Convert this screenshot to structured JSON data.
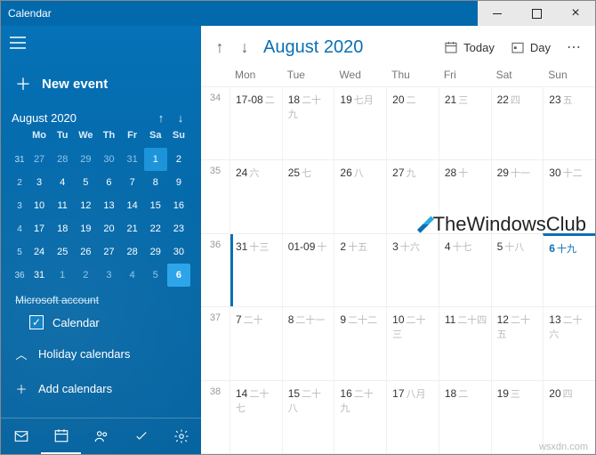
{
  "window": {
    "title": "Calendar"
  },
  "sidebar": {
    "new_event": "New event",
    "mini_month": "August 2020",
    "dows": [
      "Mo",
      "Tu",
      "We",
      "Th",
      "Fr",
      "Sa",
      "Su"
    ],
    "weeks": [
      {
        "wn": "31",
        "days": [
          {
            "n": "27",
            "cls": "prev"
          },
          {
            "n": "28",
            "cls": "prev"
          },
          {
            "n": "29",
            "cls": "prev"
          },
          {
            "n": "30",
            "cls": "prev"
          },
          {
            "n": "31",
            "cls": "prev"
          },
          {
            "n": "1",
            "cls": "hl"
          },
          {
            "n": "2",
            "cls": ""
          }
        ]
      },
      {
        "wn": "2",
        "days": [
          {
            "n": "3"
          },
          {
            "n": "4"
          },
          {
            "n": "5"
          },
          {
            "n": "6"
          },
          {
            "n": "7"
          },
          {
            "n": "8"
          },
          {
            "n": "9"
          }
        ]
      },
      {
        "wn": "3",
        "days": [
          {
            "n": "10"
          },
          {
            "n": "11"
          },
          {
            "n": "12"
          },
          {
            "n": "13"
          },
          {
            "n": "14"
          },
          {
            "n": "15"
          },
          {
            "n": "16"
          }
        ]
      },
      {
        "wn": "4",
        "days": [
          {
            "n": "17"
          },
          {
            "n": "18"
          },
          {
            "n": "19"
          },
          {
            "n": "20"
          },
          {
            "n": "21"
          },
          {
            "n": "22"
          },
          {
            "n": "23"
          }
        ]
      },
      {
        "wn": "5",
        "days": [
          {
            "n": "24"
          },
          {
            "n": "25"
          },
          {
            "n": "26"
          },
          {
            "n": "27"
          },
          {
            "n": "28"
          },
          {
            "n": "29"
          },
          {
            "n": "30"
          }
        ]
      },
      {
        "wn": "36",
        "days": [
          {
            "n": "31"
          },
          {
            "n": "1",
            "cls": "next"
          },
          {
            "n": "2",
            "cls": "next"
          },
          {
            "n": "3",
            "cls": "next"
          },
          {
            "n": "4",
            "cls": "next"
          },
          {
            "n": "5",
            "cls": "next"
          },
          {
            "n": "6",
            "cls": "sel"
          }
        ]
      }
    ],
    "account": "Microsoft account",
    "calendar_check": "Calendar",
    "holiday": "Holiday calendars",
    "add": "Add calendars"
  },
  "toolbar": {
    "title": "August 2020",
    "today": "Today",
    "day": "Day"
  },
  "main": {
    "dows": [
      "Mon",
      "Tue",
      "Wed",
      "Thu",
      "Fri",
      "Sat",
      "Sun"
    ],
    "weeks": [
      {
        "wn": "34",
        "cells": [
          {
            "d": "17-08",
            "alt": "二",
            "cls": ""
          },
          {
            "d": "18",
            "alt": "二十九"
          },
          {
            "d": "19",
            "alt": "七月"
          },
          {
            "d": "20",
            "alt": "二"
          },
          {
            "d": "21",
            "alt": "三"
          },
          {
            "d": "22",
            "alt": "四"
          },
          {
            "d": "23",
            "alt": "五"
          }
        ]
      },
      {
        "wn": "35",
        "cells": [
          {
            "d": "24",
            "alt": "六"
          },
          {
            "d": "25",
            "alt": "七"
          },
          {
            "d": "26",
            "alt": "八"
          },
          {
            "d": "27",
            "alt": "九"
          },
          {
            "d": "28",
            "alt": "十"
          },
          {
            "d": "29",
            "alt": "十一"
          },
          {
            "d": "30",
            "alt": "十二"
          }
        ]
      },
      {
        "wn": "36",
        "cells": [
          {
            "d": "31",
            "alt": "十三",
            "cls": "today"
          },
          {
            "d": "01-09",
            "alt": "十"
          },
          {
            "d": "2",
            "alt": "十五"
          },
          {
            "d": "3",
            "alt": "十六"
          },
          {
            "d": "4",
            "alt": "十七"
          },
          {
            "d": "5",
            "alt": "十八"
          },
          {
            "d": "6",
            "alt": "十九",
            "cls": "sel"
          }
        ]
      },
      {
        "wn": "37",
        "cells": [
          {
            "d": "7",
            "alt": "二十"
          },
          {
            "d": "8",
            "alt": "二十一"
          },
          {
            "d": "9",
            "alt": "二十二"
          },
          {
            "d": "10",
            "alt": "二十三"
          },
          {
            "d": "11",
            "alt": "二十四"
          },
          {
            "d": "12",
            "alt": "二十五"
          },
          {
            "d": "13",
            "alt": "二十六"
          }
        ]
      },
      {
        "wn": "38",
        "cells": [
          {
            "d": "14",
            "alt": "二十七"
          },
          {
            "d": "15",
            "alt": "二十八"
          },
          {
            "d": "16",
            "alt": "二十九"
          },
          {
            "d": "17",
            "alt": "八月"
          },
          {
            "d": "18",
            "alt": "二"
          },
          {
            "d": "19",
            "alt": "三"
          },
          {
            "d": "20",
            "alt": "四"
          }
        ]
      }
    ]
  },
  "watermark": "TheWindowsClub",
  "attrib": "wsxdn.com"
}
